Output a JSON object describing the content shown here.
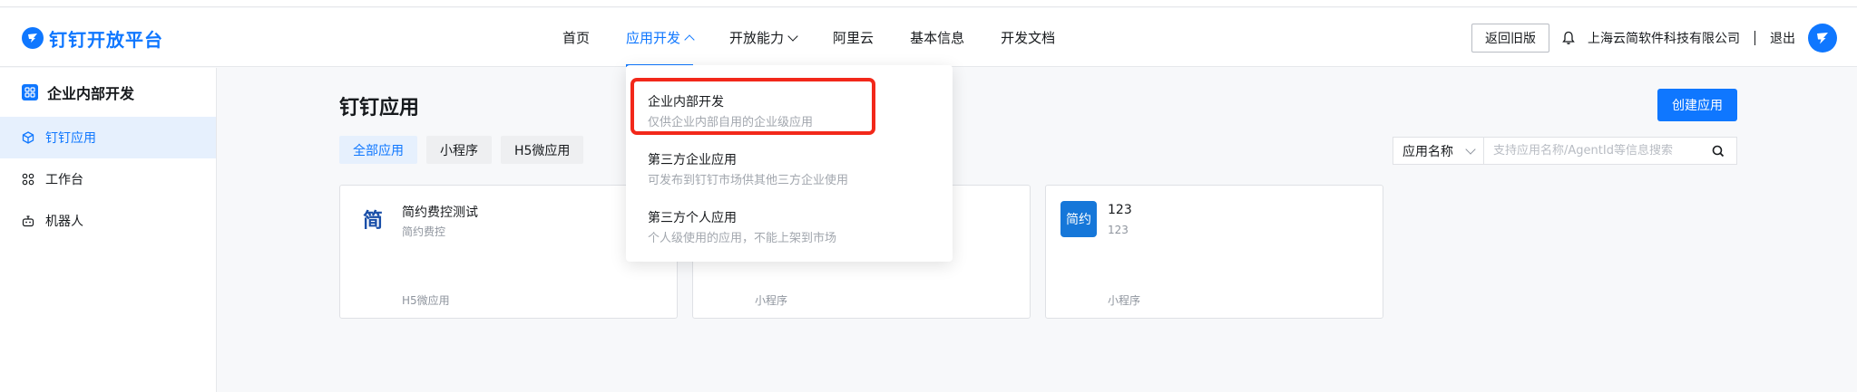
{
  "header": {
    "logo_text": "钉钉开放平台",
    "nav": [
      {
        "label": "首页"
      },
      {
        "label": "应用开发"
      },
      {
        "label": "开放能力"
      },
      {
        "label": "阿里云"
      },
      {
        "label": "基本信息"
      },
      {
        "label": "开发文档"
      }
    ],
    "back_old_label": "返回旧版",
    "company": "上海云简软件科技有限公司",
    "logout_label": "退出"
  },
  "sidebar": {
    "title": "企业内部开发",
    "items": [
      {
        "label": "钉钉应用"
      },
      {
        "label": "工作台"
      },
      {
        "label": "机器人"
      }
    ]
  },
  "main": {
    "title": "钉钉应用",
    "create_label": "创建应用",
    "filters": [
      {
        "label": "全部应用"
      },
      {
        "label": "小程序"
      },
      {
        "label": "H5微应用"
      }
    ],
    "search": {
      "select_label": "应用名称",
      "placeholder": "支持应用名称/AgentId等信息搜索"
    },
    "cards": [
      {
        "icon_text": "简",
        "name": "简约费控测试",
        "desc": "简约费控",
        "type": "H5微应用"
      },
      {
        "icon_text": "",
        "name": "",
        "desc": "",
        "type": "小程序"
      },
      {
        "icon_text": "简约",
        "name": "123",
        "desc": "123",
        "type": "小程序"
      }
    ]
  },
  "dropdown": {
    "items": [
      {
        "title": "企业内部开发",
        "sub": "仅供企业内部自用的企业级应用"
      },
      {
        "title": "第三方企业应用",
        "sub": "可发布到钉钉市场供其他三方企业使用"
      },
      {
        "title": "第三方个人应用",
        "sub": "个人级使用的应用，不能上架到市场"
      }
    ]
  },
  "colors": {
    "accent": "#0f77ff",
    "highlight": "#f2281a"
  }
}
